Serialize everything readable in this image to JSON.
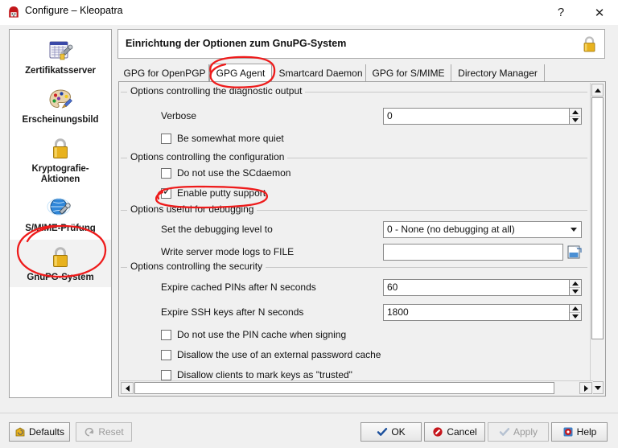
{
  "window": {
    "title": "Configure – Kleopatra",
    "icon": "kleopatra-icon",
    "help_label": "?",
    "close_label": "✕"
  },
  "sidebar": {
    "items": [
      {
        "label": "Zertifikatsserver",
        "icon": "certificate-server-icon",
        "selected": false
      },
      {
        "label": "Erscheinungsbild",
        "icon": "palette-icon",
        "selected": false
      },
      {
        "label": "Kryptografie-\nAktionen",
        "label_line1": "Kryptografie-",
        "label_line2": "Aktionen",
        "icon": "padlock-icon",
        "selected": false
      },
      {
        "label": "S/MIME-Prüfung",
        "icon": "globe-wrench-icon",
        "selected": false
      },
      {
        "label": "GnuPG-System",
        "icon": "padlock-gold-icon",
        "selected": true
      }
    ]
  },
  "header": {
    "title": "Einrichtung der Optionen zum GnuPG-System",
    "lock_icon": "padlock-gold-icon"
  },
  "tabs": [
    {
      "label": "GPG for OpenPGP",
      "active": false
    },
    {
      "label": "GPG Agent",
      "active": true
    },
    {
      "label": "Smartcard Daemon",
      "active": false
    },
    {
      "label": "GPG for S/MIME",
      "active": false
    },
    {
      "label": "Directory Manager",
      "active": false
    }
  ],
  "groups": [
    {
      "title": "Options controlling the diagnostic output",
      "rows": [
        {
          "kind": "spin",
          "label": "Verbose",
          "value": "0"
        },
        {
          "kind": "checkbox",
          "label": "Be somewhat more quiet",
          "checked": false
        }
      ]
    },
    {
      "title": "Options controlling the configuration",
      "rows": [
        {
          "kind": "checkbox",
          "label": "Do not use the SCdaemon",
          "checked": false
        },
        {
          "kind": "checkbox",
          "label": "Enable putty support",
          "checked": true
        }
      ]
    },
    {
      "title": "Options useful for debugging",
      "rows": [
        {
          "kind": "combo",
          "label": "Set the debugging level to",
          "value": "0 - None (no debugging at all)"
        },
        {
          "kind": "file",
          "label": "Write server mode logs to FILE",
          "value": "",
          "placeholder": ""
        }
      ]
    },
    {
      "title": "Options controlling the security",
      "rows": [
        {
          "kind": "spin",
          "label": "Expire cached PINs after N seconds",
          "value": "60"
        },
        {
          "kind": "spin",
          "label": "Expire SSH keys after N seconds",
          "value": "1800"
        },
        {
          "kind": "checkbox",
          "label": "Do not use the PIN cache when signing",
          "checked": false
        },
        {
          "kind": "checkbox",
          "label": "Disallow the use of an external password cache",
          "checked": false
        },
        {
          "kind": "checkbox",
          "label": "Disallow clients to mark keys as \"trusted\"",
          "checked": false
        }
      ]
    }
  ],
  "buttons": {
    "defaults": {
      "label": "Defaults",
      "icon": "defaults-icon",
      "enabled": true
    },
    "reset": {
      "label": "Reset",
      "icon": "reset-icon",
      "enabled": false
    },
    "ok": {
      "label": "OK",
      "icon": "check-icon",
      "enabled": true
    },
    "cancel": {
      "label": "Cancel",
      "icon": "cancel-icon",
      "enabled": true
    },
    "apply": {
      "label": "Apply",
      "icon": "check-icon",
      "enabled": false
    },
    "help": {
      "label": "Help",
      "icon": "help-icon",
      "enabled": true
    }
  },
  "annotations": {
    "color": "#ee1b1b",
    "marks": [
      "circle-around-gpg-agent-tab",
      "circle-around-enable-putty-support",
      "circle-around-gnupg-system-sidebar-item"
    ]
  },
  "colors": {
    "accent_red": "#ee1b1b",
    "window_bg": "#f0f0f0",
    "panel_bg": "#ffffff",
    "border": "#9e9e9e",
    "gold": "#e3b52a"
  }
}
